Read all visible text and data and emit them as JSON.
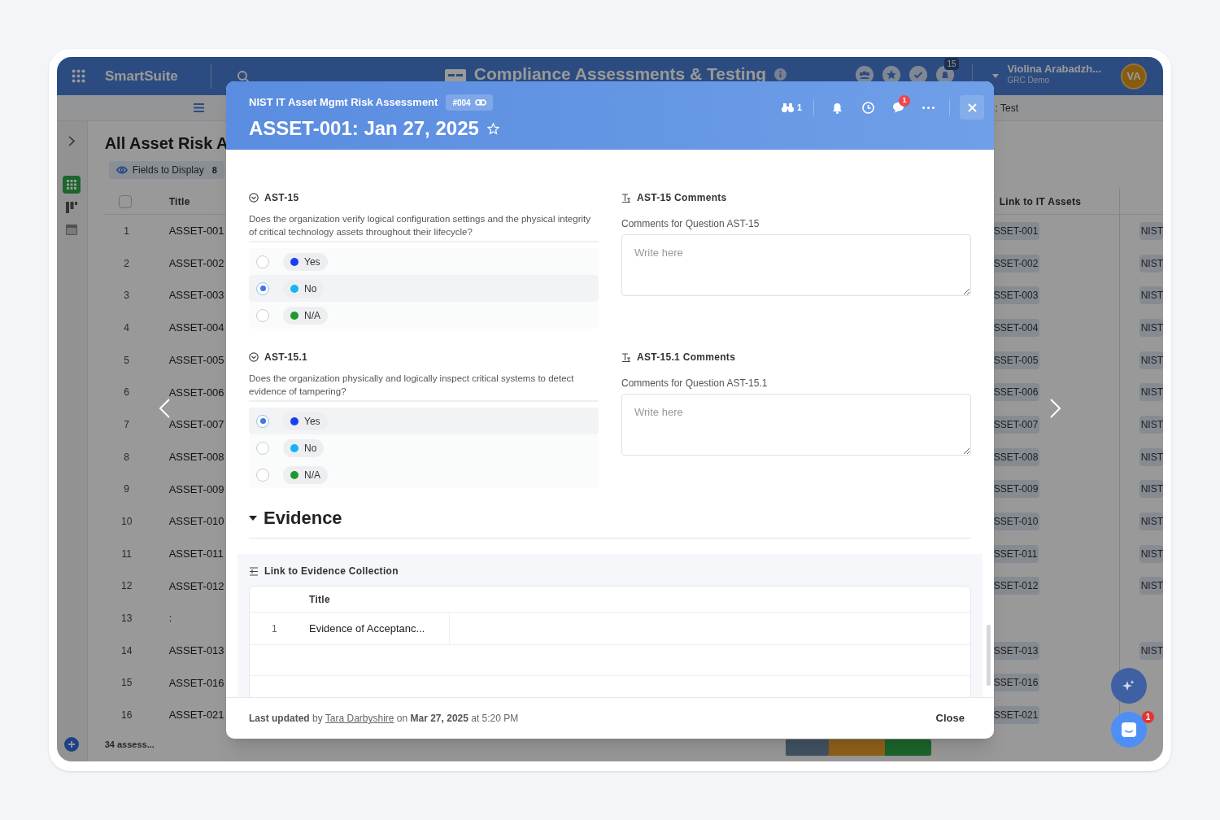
{
  "app": {
    "logo": "SmartSuite",
    "title": "Compliance Assessments & Testing",
    "notification_count": "15",
    "user": {
      "name": "Violina Arabadzh...",
      "org": "GRC Demo",
      "initials": "VA"
    },
    "view_tab": ": Test"
  },
  "view": {
    "title": "All Asset Risk A",
    "fields_button": "Fields to Display",
    "fields_count": "8",
    "columns": [
      "Title",
      "Link to IT Assets"
    ],
    "rows": [
      {
        "number": "1",
        "title": "ASSET-001",
        "link": "SSET-001",
        "column_4": "NIST"
      },
      {
        "number": "2",
        "title": "ASSET-002",
        "link": "SSET-002",
        "column_4": "NIST"
      },
      {
        "number": "3",
        "title": "ASSET-003",
        "link": "SSET-003",
        "column_4": "NIST"
      },
      {
        "number": "4",
        "title": "ASSET-004",
        "link": "SSET-004",
        "column_4": "NIST"
      },
      {
        "number": "5",
        "title": "ASSET-005",
        "link": "SSET-005",
        "column_4": "NIST"
      },
      {
        "number": "6",
        "title": "ASSET-006",
        "link": "SSET-006",
        "column_4": "NIST"
      },
      {
        "number": "7",
        "title": "ASSET-007",
        "link": "SSET-007",
        "column_4": "NIST"
      },
      {
        "number": "8",
        "title": "ASSET-008",
        "link": "SSET-008",
        "column_4": "NIST"
      },
      {
        "number": "9",
        "title": "ASSET-009",
        "link": "SSET-009",
        "column_4": "NIST"
      },
      {
        "number": "10",
        "title": "ASSET-010",
        "link": "SSET-010",
        "column_4": "NIST"
      },
      {
        "number": "11",
        "title": "ASSET-011",
        "link": "SSET-011",
        "column_4": "NIST"
      },
      {
        "number": "12",
        "title": "ASSET-012",
        "link": "SSET-012",
        "column_4": "NIST"
      },
      {
        "number": "13",
        "title": ":"
      },
      {
        "number": "14",
        "title": "ASSET-013",
        "link": "SSET-013",
        "column_4": "NIST"
      },
      {
        "number": "15",
        "title": "ASSET-016",
        "link": "SSET-016"
      },
      {
        "number": "16",
        "title": "ASSET-021",
        "link": "SSET-021"
      }
    ],
    "select_all": {
      "checked": false
    },
    "footer": "34 assess..."
  },
  "record": {
    "app_name": "NIST IT Asset Mgmt Risk Assessment",
    "record_id": "#004",
    "title": "ASSET-001: Jan 27, 2025",
    "watchers": "1",
    "comments_badge": "1",
    "questions": [
      {
        "code": "AST-15",
        "text": "Does the organization verify logical configuration settings and the physical integrity of critical technology assets throughout their lifecycle?",
        "options": [
          {
            "label": "Yes",
            "color": "#1a3df2",
            "selected": false
          },
          {
            "label": "No",
            "color": "#16b3f7",
            "selected": true
          },
          {
            "label": "N/A",
            "color": "#1e9a2a",
            "selected": false
          }
        ],
        "comments_label": "AST-15 Comments",
        "comments_help": "Comments for Question AST-15",
        "comments_placeholder": "Write here"
      },
      {
        "code": "AST-15.1",
        "text": "Does the organization physically and logically inspect critical systems to detect evidence of tampering?",
        "options": [
          {
            "label": "Yes",
            "color": "#1a3df2",
            "selected": true
          },
          {
            "label": "No",
            "color": "#16b3f7",
            "selected": false
          },
          {
            "label": "N/A",
            "color": "#1e9a2a",
            "selected": false
          }
        ],
        "comments_label": "AST-15.1 Comments",
        "comments_help": "Comments for Question AST-15.1",
        "comments_placeholder": "Write here"
      }
    ],
    "section": {
      "title": "Evidence",
      "expanded": true
    },
    "linked": {
      "label": "Link to Evidence Collection",
      "column": "Title",
      "rows": [
        {
          "number": "1",
          "title": "Evidence of Acceptanc..."
        }
      ]
    },
    "footer": {
      "before": "**Last updated** by",
      "author": "Tara Darbyshire",
      "after": "on **Mar 27, 2025** at 5:20 PM",
      "close_button": "Close"
    }
  },
  "chat_badge": "1"
}
